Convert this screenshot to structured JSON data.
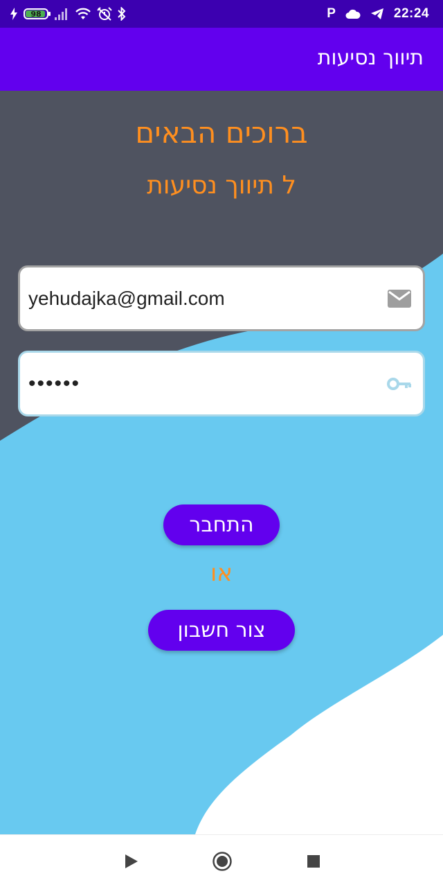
{
  "status_bar": {
    "battery_level": "98",
    "carrier_letter": "P",
    "time": "22:24",
    "icons": [
      "charging-bolt-icon",
      "battery-icon",
      "signal-icon",
      "wifi-icon",
      "alarm-off-icon",
      "bluetooth-icon",
      "parking-icon",
      "cloud-icon",
      "telegram-icon"
    ]
  },
  "app_bar": {
    "title": "תיווך נסיעות"
  },
  "welcome": {
    "line1": "ברוכים הבאים",
    "line2": "ל תיווך נסיעות"
  },
  "form": {
    "email_value": "yehudajka@gmail.com",
    "email_icon": "mail-icon",
    "password_value": "••••••",
    "password_icon": "key-icon"
  },
  "actions": {
    "login_label": "התחבר",
    "or_label": "או",
    "register_label": "צור חשבון"
  },
  "colors": {
    "status_bar": "#3c00b0",
    "app_bar": "#6200ee",
    "background_dark": "#4f5360",
    "wave_light_blue": "#68c9f0",
    "accent_orange": "#ff8f1f",
    "button": "#6200ee"
  },
  "nav_bar": {
    "icons": [
      "back-triangle-icon",
      "home-circle-icon",
      "recents-square-icon"
    ]
  }
}
